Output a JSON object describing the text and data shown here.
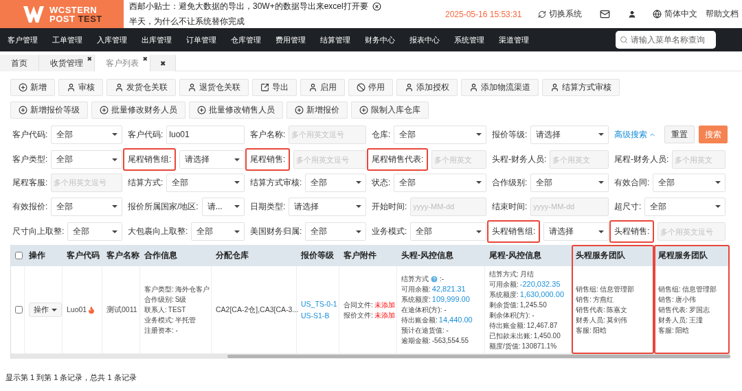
{
  "header": {
    "logo": {
      "word": "WCSTERN",
      "line2a": "POST",
      "line2b": "TEST"
    },
    "notice": [
      "西邮小贴士：避免大数据的导出，30W+的数据导出来excel打开要",
      "半天，为什么不让系统替你完成"
    ],
    "datetime": "2025-05-16 15:53:31",
    "switch_system": "切换系统",
    "language": "简体中文",
    "help": "帮助文档"
  },
  "nav": {
    "items": [
      "客户管理",
      "工单管理",
      "入库管理",
      "出库管理",
      "订单管理",
      "仓库管理",
      "费用管理",
      "结算管理",
      "财务中心",
      "报表中心",
      "系统管理",
      "渠道管理"
    ],
    "search_placeholder": "请输入菜单名称查询"
  },
  "tabs": [
    {
      "label": "首页",
      "closable": false,
      "selected": false
    },
    {
      "label": "收货管理",
      "closable": true,
      "selected": false
    },
    {
      "label": "客户列表",
      "closable": true,
      "selected": true
    }
  ],
  "close_glyph": "✖",
  "toolbar": [
    {
      "label": "新增",
      "kind": "plus"
    },
    {
      "label": "审核",
      "kind": "user"
    },
    {
      "label": "发货仓关联",
      "kind": "user"
    },
    {
      "label": "退货仓关联",
      "kind": "user"
    },
    {
      "label": "导出",
      "kind": "export"
    },
    {
      "label": "启用",
      "kind": "user"
    },
    {
      "label": "停用",
      "kind": "ban"
    },
    {
      "label": "添加授权",
      "kind": "user"
    },
    {
      "label": "添加物流渠道",
      "kind": "user"
    },
    {
      "label": "结算方式审核",
      "kind": "user"
    },
    {
      "label": "新增报价等级",
      "kind": "plus"
    },
    {
      "label": "批量修改财务人员",
      "kind": "plus"
    },
    {
      "label": "批量修改销售人员",
      "kind": "plus"
    },
    {
      "label": "新增报价",
      "kind": "plus"
    },
    {
      "label": "限制入库仓库",
      "kind": "plus"
    }
  ],
  "filters": [
    [
      {
        "label": "客户代码:",
        "kind": "select",
        "value": "全部",
        "highlighted": false
      },
      {
        "label": "客户代码:",
        "kind": "input",
        "value": "luo01",
        "highlighted": false
      },
      {
        "label": "客户名称:",
        "kind": "placeholder",
        "placeholder": "多个用英文逗号",
        "highlighted": false
      },
      {
        "label": "仓库:",
        "kind": "select",
        "value": "全部",
        "highlighted": false
      },
      {
        "label": "报价等级:",
        "kind": "select",
        "value": "请选择",
        "highlighted": false
      }
    ],
    [
      {
        "label": "客户类型:",
        "kind": "select",
        "value": "全部",
        "highlighted": false
      },
      {
        "label": "尾程销售组:",
        "kind": "select",
        "value": "请选择",
        "highlighted": true
      },
      {
        "label": "尾程销售:",
        "kind": "placeholder",
        "placeholder": "多个用英文逗号",
        "highlighted": true
      },
      {
        "label": "尾程销售代表:",
        "kind": "placeholder",
        "placeholder": "多个用英文",
        "highlighted": true
      },
      {
        "label": "头程-财务人员:",
        "kind": "placeholder",
        "placeholder": "多个用英文",
        "highlighted": false
      },
      {
        "label": "尾程-财务人员:",
        "kind": "placeholder",
        "placeholder": "多个用英文",
        "highlighted": false
      }
    ],
    [
      {
        "label": "尾程客服:",
        "kind": "placeholder",
        "placeholder": "多个用英文逗号",
        "highlighted": false
      },
      {
        "label": "结算方式:",
        "kind": "select",
        "value": "全部",
        "highlighted": false
      },
      {
        "label": "结算方式审核:",
        "kind": "select",
        "value": "全部",
        "highlighted": false
      },
      {
        "label": "状态:",
        "kind": "select",
        "value": "全部",
        "highlighted": false
      },
      {
        "label": "合作级别:",
        "kind": "select",
        "value": "全部",
        "highlighted": false
      },
      {
        "label": "有效合同:",
        "kind": "select",
        "value": "全部",
        "highlighted": false
      }
    ],
    [
      {
        "label": "有效报价:",
        "kind": "select",
        "value": "全部",
        "highlighted": false
      },
      {
        "label": "报价所属国家/地区:",
        "kind": "select",
        "value": "请...",
        "highlighted": false
      },
      {
        "label": "日期类型:",
        "kind": "select",
        "value": "请选择",
        "highlighted": false
      },
      {
        "label": "开始时间:",
        "kind": "placeholder",
        "placeholder": "yyyy-MM-dd",
        "highlighted": false
      },
      {
        "label": "结束时间:",
        "kind": "placeholder",
        "placeholder": "yyyy-MM-dd",
        "highlighted": false
      },
      {
        "label": "超尺寸:",
        "kind": "select",
        "value": "全部",
        "highlighted": false
      }
    ],
    [
      {
        "label": "尺寸向上取整:",
        "kind": "select",
        "value": "全部",
        "highlighted": false
      },
      {
        "label": "大包裹向上取整:",
        "kind": "select",
        "value": "全部",
        "highlighted": false
      },
      {
        "label": "美国财务归属:",
        "kind": "select",
        "value": "全部",
        "highlighted": false
      },
      {
        "label": "业务模式:",
        "kind": "select",
        "value": "全部",
        "highlighted": false
      },
      {
        "label": "头程销售组:",
        "kind": "select",
        "value": "请选择",
        "highlighted": true
      },
      {
        "label": "头程销售:",
        "kind": "placeholder",
        "placeholder": "多个用英文逗号",
        "highlighted": true
      }
    ]
  ],
  "filter_actions": {
    "advanced": "高级搜索",
    "reset": "重置",
    "search": "搜索"
  },
  "table": {
    "header_checkbox": {
      "checked": false
    },
    "columns": [
      {
        "label": "操作",
        "highlighted": false
      },
      {
        "label": "客户代码",
        "highlighted": false
      },
      {
        "label": "客户名称",
        "highlighted": false
      },
      {
        "label": "合作信息",
        "highlighted": false
      },
      {
        "label": "分配仓库",
        "highlighted": false
      },
      {
        "label": "报价等级",
        "highlighted": false
      },
      {
        "label": "客户附件",
        "highlighted": false
      },
      {
        "label": "头程-风控信息",
        "highlighted": false
      },
      {
        "label": "尾程-风控信息",
        "highlighted": false
      },
      {
        "label": "头程服务团队",
        "highlighted": true
      },
      {
        "label": "尾程服务团队",
        "highlighted": true
      }
    ],
    "rows": [
      {
        "checked": false,
        "cells": [
          {
            "kind": "action",
            "text": "操作"
          },
          {
            "kind": "code",
            "text": "Luo01"
          },
          {
            "kind": "text",
            "text": "测试0011"
          },
          {
            "kind": "lines",
            "lines": [
              {
                "label": "客户类型: ",
                "value": "海外仓客户",
                "kind": "plain"
              },
              {
                "label": "合作级别: ",
                "value": "S级",
                "kind": "plain"
              },
              {
                "label": "联系人: ",
                "value": "TEST",
                "kind": "plain"
              },
              {
                "label": "业务模式: ",
                "value": "半托管",
                "kind": "plain"
              },
              {
                "text": "注册资本: -",
                "kind": "text"
              }
            ]
          },
          {
            "kind": "text",
            "text": "CA2[CA-2仓],CA3[CA-3..."
          },
          {
            "kind": "links",
            "links": [
              "US_TS-0-1",
              "US-S1-B"
            ]
          },
          {
            "kind": "lines",
            "lines": [
              {
                "label": "合同文件:",
                "value": "未添加",
                "kind": "danger"
              },
              {
                "label": "报价文件:",
                "value": "未添加",
                "kind": "danger"
              }
            ]
          },
          {
            "kind": "lines",
            "lines": [
              {
                "label": "结算方式",
                "value": ":-",
                "kind": "plain",
                "help": true
              },
              {
                "label": "可用余额: ",
                "value": "42,821.31",
                "kind": "link",
                "help": false
              },
              {
                "label": "系统额度: ",
                "value": "109,999.00",
                "kind": "link",
                "help": false
              },
              {
                "text": "在途体积(方): -",
                "kind": "text"
              },
              {
                "label": "待出账金额: ",
                "value": "14,440.00",
                "kind": "link",
                "help": false
              },
              {
                "text": "预计在途货值: -",
                "kind": "text"
              },
              {
                "label": "逾期金额: ",
                "value": "-563,554.55",
                "kind": "plain",
                "help": false
              }
            ]
          },
          {
            "kind": "lines",
            "lines": [
              {
                "label": "结算方式: ",
                "value": "月结",
                "kind": "plain"
              },
              {
                "label": "可用余额: ",
                "value": "-220,032.35",
                "kind": "link"
              },
              {
                "label": "系统额度: ",
                "value": "1,630,000.00",
                "kind": "link"
              },
              {
                "label": "剩余货值: ",
                "value": "1,245.50",
                "kind": "plain"
              },
              {
                "text": "剩余体积(方): -",
                "kind": "text"
              },
              {
                "label": "待出账金额: ",
                "value": "12,467.87",
                "kind": "plain"
              },
              {
                "label": "已扣款未出账: ",
                "value": "1,450.00",
                "kind": "plain"
              },
              {
                "label": "额度/货值: ",
                "value": "130871.1%",
                "kind": "plain"
              }
            ]
          },
          {
            "kind": "lines",
            "lines": [
              {
                "label": "销售组: ",
                "value": "信息管理部",
                "kind": "plain"
              },
              {
                "label": "销售: ",
                "value": "方燕红",
                "kind": "plain"
              },
              {
                "label": "销售代表: ",
                "value": "陈嘉文",
                "kind": "plain"
              },
              {
                "label": "财务人员: ",
                "value": "莫剑伟",
                "kind": "plain"
              },
              {
                "label": "客服: ",
                "value": "阳晗",
                "kind": "plain"
              }
            ]
          },
          {
            "kind": "lines",
            "lines": [
              {
                "label": "销售组: ",
                "value": "信息管理部",
                "kind": "plain"
              },
              {
                "label": "销售: ",
                "value": "唐小伟",
                "kind": "plain"
              },
              {
                "label": "销售代表: ",
                "value": "罗国志",
                "kind": "plain"
              },
              {
                "label": "财务人员: ",
                "value": "王潼",
                "kind": "plain"
              },
              {
                "label": "客服: ",
                "value": "阳晗",
                "kind": "plain"
              }
            ]
          }
        ]
      }
    ]
  },
  "footer": "显示第 1 到第 1 条记录，总共 1 条记录"
}
